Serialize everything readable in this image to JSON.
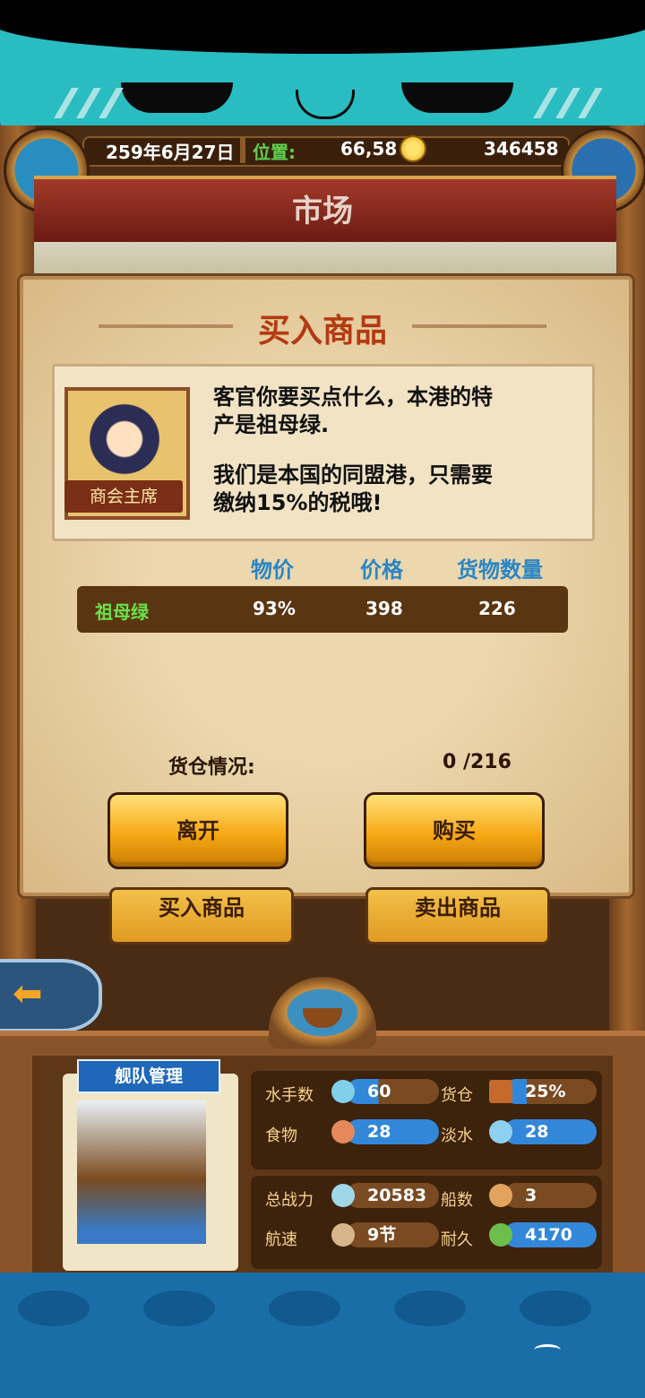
{
  "header": {
    "date": "259年6月27日",
    "position_label": "位置:",
    "coords": "66,58",
    "gold": "346458"
  },
  "page_title": "市场",
  "dialog": {
    "title": "买入商品",
    "npc_label": "商会主席",
    "message_line1": "客官你要买点什么，本港的特",
    "message_line2": "产是祖母绿.",
    "message_line3": "我们是本国的同盟港，只需要",
    "message_line4": "缴纳15%的税哦!",
    "columns": [
      "物价",
      "价格",
      "货物数量"
    ],
    "row": {
      "name": "祖母绿",
      "price_index": "93%",
      "price": "398",
      "quantity": "226"
    },
    "cargo_label": "货仓情况:",
    "cargo_value": "0 /216",
    "leave_button": "离开",
    "buy_button": "购买"
  },
  "market_tabs": {
    "buy": "买入商品",
    "sell": "卖出商品"
  },
  "fleet": {
    "title": "舰队管理",
    "stats": {
      "sailors_label": "水手数",
      "sailors": "60",
      "cargo_label": "货仓",
      "cargo": "25%",
      "food_label": "食物",
      "food": "28",
      "water_label": "淡水",
      "water": "28",
      "power_label": "总战力",
      "power": "20583",
      "ships_label": "船数",
      "ships": "3",
      "speed_label": "航速",
      "speed": "9节",
      "durability_label": "耐久",
      "durability": "4170"
    }
  },
  "colors": {
    "accent_orange": "#f7a915",
    "header_blue": "#2b86c5",
    "title_red": "#b33a12"
  }
}
